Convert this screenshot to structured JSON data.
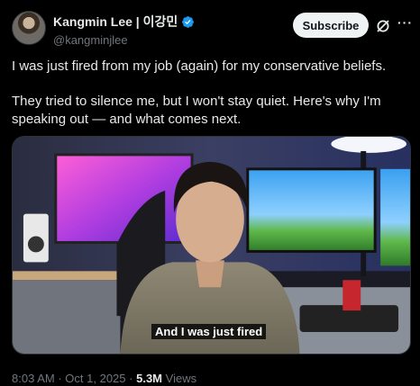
{
  "author": {
    "display_name": "Kangmin Lee | 이강민",
    "handle": "@kangminjlee",
    "verified_icon": "verified-badge-icon"
  },
  "actions": {
    "subscribe_label": "Subscribe",
    "grok_icon": "grok-icon",
    "more_icon": "more-icon"
  },
  "tweet": {
    "paragraphs": [
      "I was just fired from my job (again) for my conservative beliefs.",
      "They tried to silence me, but I won't stay quiet. Here's why I'm speaking out — and what comes next."
    ]
  },
  "media": {
    "caption": "And I was just fired"
  },
  "meta": {
    "time": "8:03 AM",
    "date": "Oct 1, 2025",
    "separator": "·",
    "views_count": "5.3M",
    "views_label": "Views"
  },
  "colors": {
    "background": "#000000",
    "text": "#e7e9ea",
    "muted": "#71767b",
    "verified": "#1d9bf0"
  }
}
